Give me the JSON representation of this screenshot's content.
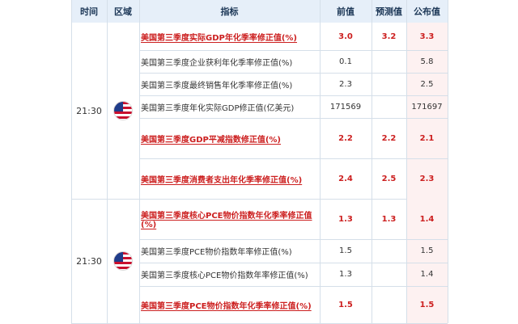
{
  "header": {
    "time": "时间",
    "region": "区域",
    "indicator": "指标",
    "previous": "前值",
    "forecast": "预测值",
    "actual": "公布值"
  },
  "groups": [
    {
      "time": "21:30",
      "flag_icon": "us-flag-icon",
      "rows": [
        {
          "name": "美国第三季度实际GDP年化季率修正值(%)",
          "previous": "3.0",
          "forecast": "3.2",
          "actual": "3.3",
          "important": true
        },
        {
          "name": "美国第三季度企业获利年化季率修正值(%)",
          "previous": "0.1",
          "forecast": "",
          "actual": "5.8",
          "important": false
        },
        {
          "name": "美国第三季度最终销售年化季率修正值(%)",
          "previous": "2.3",
          "forecast": "",
          "actual": "2.5",
          "important": false
        },
        {
          "name": "美国第三季度年化实际GDP修正值(亿美元)",
          "previous": "171569",
          "forecast": "",
          "actual": "171697",
          "important": false
        },
        {
          "name": "美国第三季度GDP平减指数修正值(%)",
          "previous": "2.2",
          "forecast": "2.2",
          "actual": "2.1",
          "important": true
        },
        {
          "name": "美国第三季度消费者支出年化季率修正值(%)",
          "previous": "2.4",
          "forecast": "2.5",
          "actual": "2.3",
          "important": true
        }
      ]
    },
    {
      "time": "21:30",
      "flag_icon": "us-flag-icon",
      "rows": [
        {
          "name": "美国第三季度核心PCE物价指数年化季率修正值(%)",
          "previous": "1.3",
          "forecast": "1.3",
          "actual": "1.4",
          "important": true
        },
        {
          "name": "美国第三季度PCE物价指数年率修正值(%)",
          "previous": "1.5",
          "forecast": "",
          "actual": "1.5",
          "important": false
        },
        {
          "name": "美国第三季度核心PCE物价指数年率修正值(%)",
          "previous": "1.3",
          "forecast": "",
          "actual": "1.4",
          "important": false
        },
        {
          "name": "美国第三季度PCE物价指数年化季率修正值(%)",
          "previous": "1.5",
          "forecast": "",
          "actual": "1.5",
          "important": true
        }
      ]
    }
  ]
}
